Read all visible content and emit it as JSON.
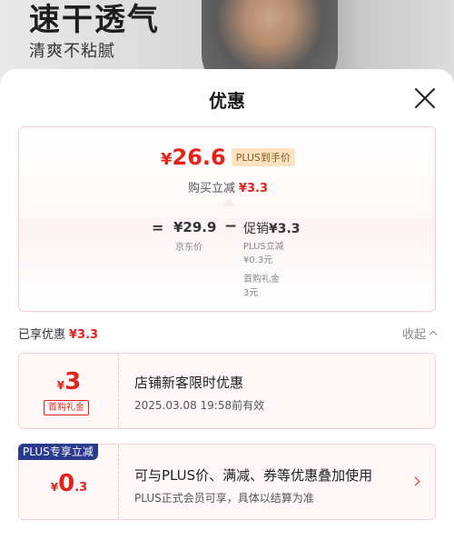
{
  "banner": {
    "title": "速干透气",
    "subtitle": "清爽不粘腻"
  },
  "sheet": {
    "title": "优惠"
  },
  "price_card": {
    "currency": "¥",
    "final_price": "26.6",
    "plus_tag": "PLUS到手价",
    "reduce_label": "购买立减",
    "reduce_value": "¥3.3",
    "eq": "=",
    "jd_price": "¥29.9",
    "jd_label": "京东价",
    "minus": "−",
    "promo_label": "促销",
    "promo_value": "¥3.3",
    "promo_items": [
      {
        "name": "PLUS立减",
        "value": "¥0.3元"
      },
      {
        "name": "首购礼金",
        "value": "3元"
      }
    ]
  },
  "enjoyed": {
    "label": "已享优惠",
    "value": "¥3.3",
    "collapse": "收起"
  },
  "coupons": [
    {
      "currency": "¥",
      "amount": "3",
      "tag": "首购礼金",
      "title": "店铺新客限时优惠",
      "desc": "2025.03.08 19:58前有效"
    },
    {
      "corner": "PLUS专享立减",
      "currency": "¥",
      "amount": "0",
      "decimal": ".3",
      "title": "可与PLUS价、满减、券等优惠叠加使用",
      "desc": "PLUS正式会员可享，具体以结算为准"
    }
  ],
  "colors": {
    "accent": "#e2231a",
    "plus_badge": "#2b3a8f",
    "plus_tag_bg": "#fbe3c1"
  }
}
